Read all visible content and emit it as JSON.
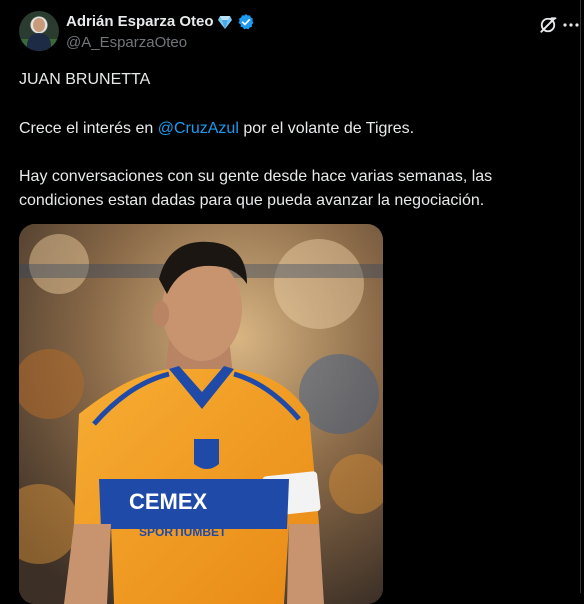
{
  "author": {
    "display_name": "Adrián Esparza Oteo",
    "handle": "@A_EsparzaOteo",
    "verified_color": "#1d9bf0",
    "badge_icon": "diamond-icon"
  },
  "actions": {
    "grok_icon": "grok-icon",
    "more_icon": "more-icon"
  },
  "post": {
    "line1": "JUAN BRUNETTA",
    "line2_before": "Crece el interés en ",
    "line2_mention": "@CruzAzul",
    "line2_after": " por el volante de Tigres.",
    "line3": "Hay conversaciones con su gente desde hace varias semanas, las",
    "line4": "condiciones estan dadas para que pueda avanzar la negociación."
  },
  "media": {
    "jersey_sponsor": "CEMEX",
    "jersey_sponsor2": "SPORTIUMBET",
    "kit_colors": {
      "primary": "#f5a023",
      "secondary": "#1f4aa8"
    }
  },
  "colors": {
    "background": "#000000",
    "text": "#e7e9ea",
    "muted": "#71767b",
    "link": "#1d9bf0"
  }
}
